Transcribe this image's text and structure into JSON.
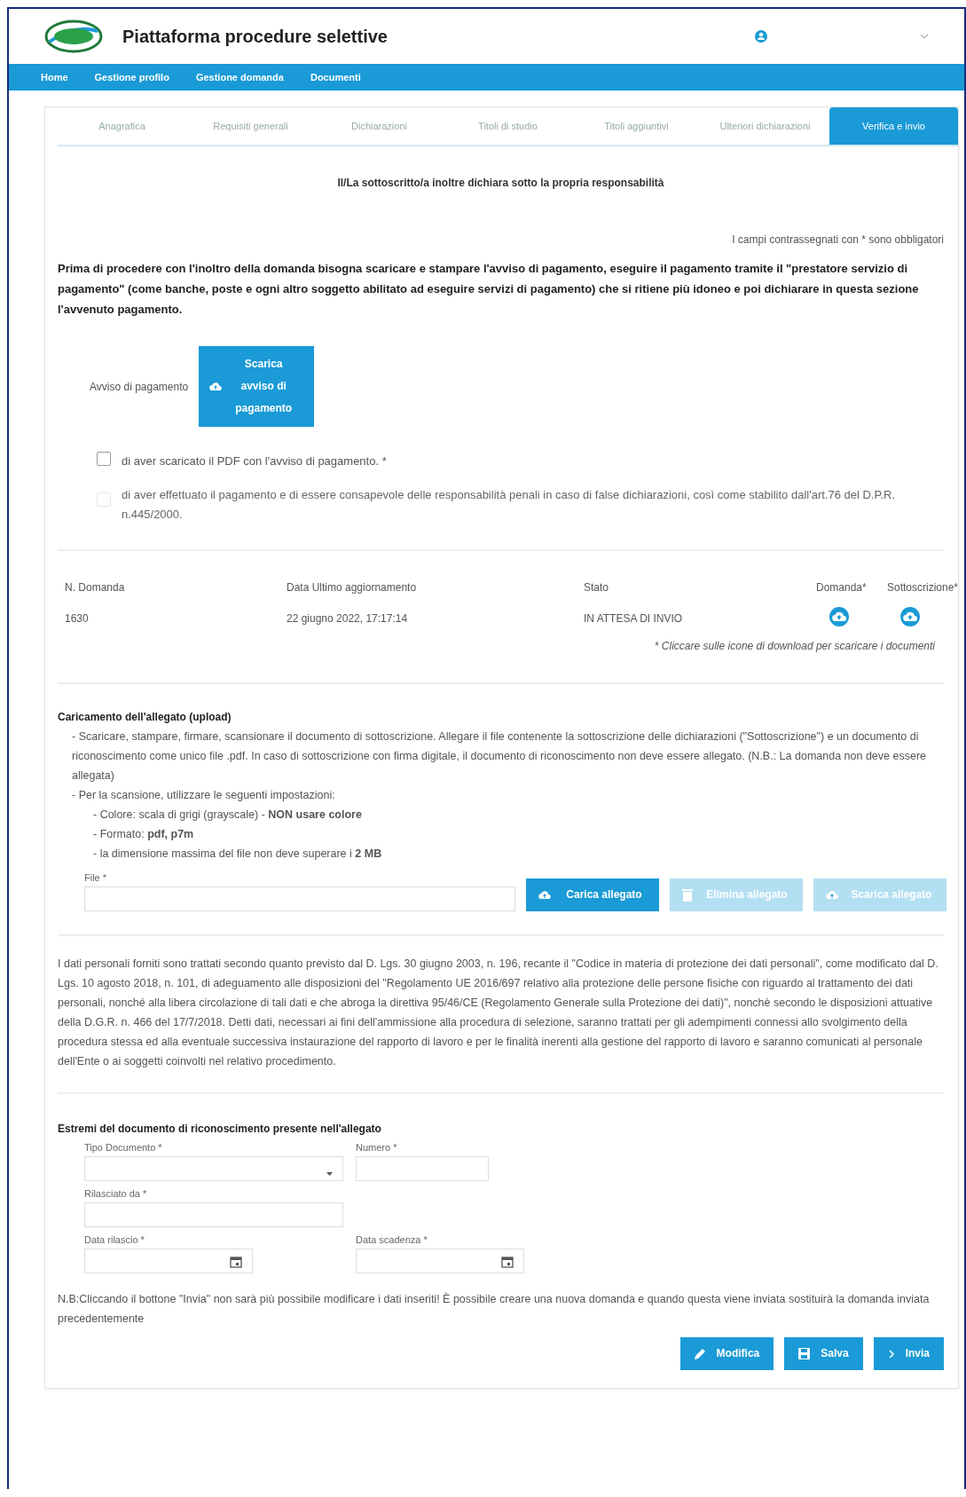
{
  "header": {
    "title": "Piattaforma procedure selettive"
  },
  "nav": [
    {
      "label": "Home"
    },
    {
      "label": "Gestione profilo"
    },
    {
      "label": "Gestione domanda"
    },
    {
      "label": "Documenti"
    }
  ],
  "tabs": [
    {
      "label": "Anagrafica",
      "selected": false
    },
    {
      "label": "Requisiti generali",
      "selected": false
    },
    {
      "label": "Dichiarazioni",
      "selected": false
    },
    {
      "label": "Titoli di studio",
      "selected": false
    },
    {
      "label": "Titoli aggiuntivi",
      "selected": false
    },
    {
      "label": "Ulteriori dichiarazioni",
      "selected": false
    },
    {
      "label": "Verifica e invio",
      "selected": true
    }
  ],
  "section_title": "Il/La sottoscritto/a inoltre dichiara sotto la propria responsabilità",
  "required_note": "I campi contrassegnati con * sono obbligatori",
  "payment_notice": "Prima di procedere con l'inoltro della domanda bisogna scaricare e stampare l'avviso di pagamento, eseguire il pagamento tramite il \"prestatore servizio di pagamento\" (come banche, poste e ogni altro soggetto abilitato ad eseguire servizi di pagamento) che si ritiene più idoneo e poi dichiarare in questa sezione l'avvenuto pagamento.",
  "payment": {
    "label": "Avviso di pagamento",
    "button": "Scarica avviso di pagamento"
  },
  "checkboxes": [
    {
      "label": "di aver scaricato il PDF con l'avviso di pagamento. *",
      "checked": false,
      "disabled": false
    },
    {
      "label": "di aver effettuato il pagamento e di essere consapevole delle responsabilità penali in caso di false dichiarazioni, così come stabilito dall'art.76 del D.P.R. n.445/2000.",
      "checked": false,
      "disabled": true
    }
  ],
  "application": {
    "columns": [
      "N. Domanda",
      "Data Ultimo aggiornamento",
      "Stato",
      "Domanda*",
      "Sottoscrizione*"
    ],
    "values": [
      "1630",
      "22 giugno 2022, 17:17:14",
      "IN ATTESA DI INVIO"
    ],
    "note": "* Cliccare sulle icone di download per scaricare i documenti"
  },
  "upload": {
    "title": "Caricamento dell'allegato (upload)",
    "lines": [
      {
        "text": "- Scaricare, stampare, firmare, scansionare il documento di sottoscrizione. Allegare il file contenente la sottoscrizione delle dichiarazioni (\"Sottoscrizione\") e un documento di riconoscimento come unico file .pdf. In caso di sottoscrizione con firma digitale, il documento di riconoscimento non deve essere allegato. (N.B.: La domanda non deve essere allegata)",
        "indent": false
      },
      {
        "text": "- Per la scansione, utilizzare le seguenti impostazioni:",
        "indent": false
      },
      {
        "text": "- Colore: scala di grigi (grayscale) - **NON usare colore**",
        "indent": true
      },
      {
        "text": "- Formato: **pdf, p7m**",
        "indent": true
      },
      {
        "text": "- la dimensione massima del file non deve superare i **2 MB**",
        "indent": true
      }
    ],
    "file_label": "File *",
    "buttons": [
      {
        "label": "Carica allegato",
        "kind": "upload",
        "disabled": false
      },
      {
        "label": "Elimina allegato",
        "kind": "delete",
        "disabled": true
      },
      {
        "label": "Scarica allegato",
        "kind": "download",
        "disabled": true
      }
    ]
  },
  "privacy": "I dati personali forniti sono trattati secondo quanto previsto dal D. Lgs. 30 giugno 2003, n. 196, recante il \"Codice in materia di protezione dei dati personali\", come modificato dal D. Lgs. 10 agosto 2018, n. 101, di adeguamento alle disposizioni del \"Regolamento UE 2016/697 relativo alla protezione delle persone fisiche con riguardo al trattamento dei dati personali, nonché alla libera circolazione di tali dati e che abroga la direttiva 95/46/CE (Regolamento Generale sulla Protezione dei dati)\", nonchè secondo le disposizioni attuative della D.G.R. n. 466 del 17/7/2018. Detti dati, necessari ai fini dell'ammissione alla procedura di selezione, saranno trattati per gli adempimenti connessi allo svolgimento della procedura stessa ed alla eventuale successiva instaurazione del rapporto di lavoro e per le finalità inerenti alla gestione del rapporto di lavoro e saranno comunicati al personale dell'Ente o ai soggetti coinvolti nel relativo procedimento.",
  "document": {
    "title": "Estremi del documento di riconoscimento presente nell'allegato",
    "fields": {
      "type": "Tipo Documento *",
      "number": "Numero *",
      "issuer": "Rilasciato da *",
      "issue_date": "Data rilascio *",
      "expiry_date": "Data scadenza *"
    }
  },
  "final_note": "N.B:Cliccando il bottone \"Invia\" non sarà più possibile modificare i dati inseriti! È possibile creare una nuova domanda e quando questa viene inviata sostituirà la domanda inviata precedentemente",
  "actions": [
    {
      "label": "Modifica",
      "kind": "edit"
    },
    {
      "label": "Salva",
      "kind": "save"
    },
    {
      "label": "Invia",
      "kind": "send"
    }
  ]
}
